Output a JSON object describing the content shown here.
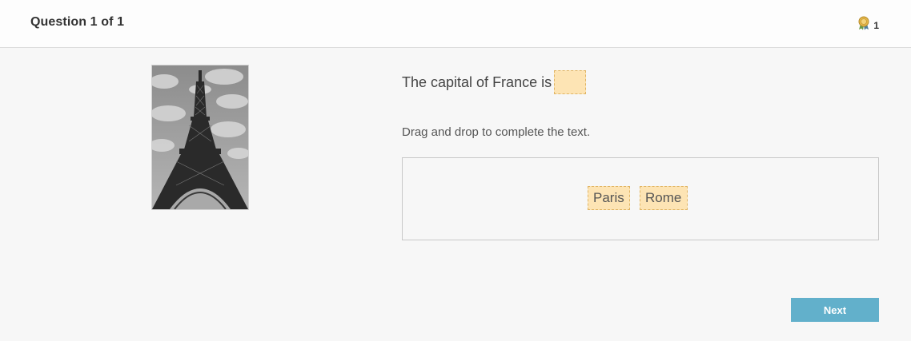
{
  "header": {
    "title": "Question 1 of 1",
    "points_icon": "medal-icon",
    "points": "1"
  },
  "question": {
    "image_description_icon": "eiffel-tower-image",
    "text": "The capital of France is",
    "instruction": "Drag and drop to complete the text."
  },
  "options": [
    {
      "label": "Paris"
    },
    {
      "label": "Rome"
    }
  ],
  "footer": {
    "next_label": "Next"
  },
  "colors": {
    "accent": "#62b0cb",
    "drop_fill": "#fde4b4",
    "drop_border": "#e0b463",
    "background": "#f7f7f7"
  }
}
